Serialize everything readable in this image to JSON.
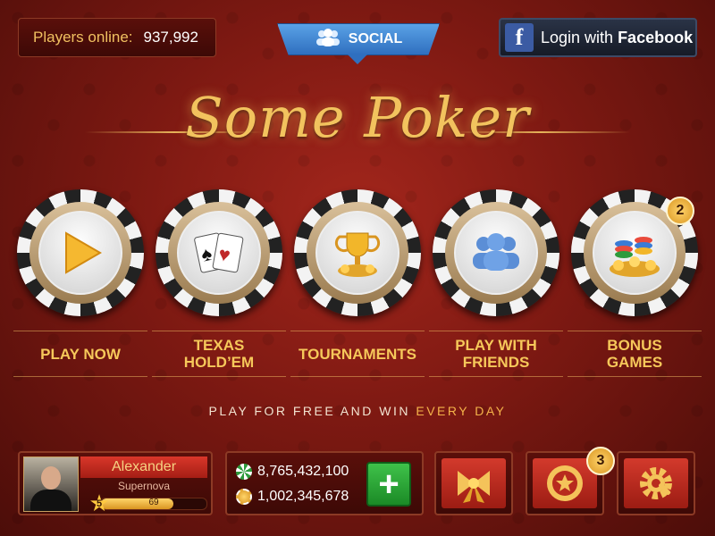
{
  "header": {
    "players_label": "Players online:",
    "players_value": "937,992",
    "social_label": "SOCIAL",
    "facebook_prefix": "Login with",
    "facebook_brand": "Facebook"
  },
  "logo": "Some Poker",
  "games": [
    {
      "label_line1": "PLAY NOW",
      "label_line2": "",
      "icon": "play-icon"
    },
    {
      "label_line1": "TEXAS",
      "label_line2": "HOLD’EM",
      "icon": "cards-icon"
    },
    {
      "label_line1": "TOURNAMENTS",
      "label_line2": "",
      "icon": "trophy-icon"
    },
    {
      "label_line1": "PLAY WITH",
      "label_line2": "FRIENDS",
      "icon": "friends-icon"
    },
    {
      "label_line1": "BONUS",
      "label_line2": "GAMES",
      "icon": "chips-icon",
      "badge": "2"
    }
  ],
  "tagline": {
    "main": "PLAY FOR FREE AND WIN",
    "highlight": "EVERY DAY"
  },
  "profile": {
    "name": "Alexander",
    "rank": "Supernova",
    "level": "5",
    "xp": "69",
    "xp_fraction": 0.69
  },
  "balance": {
    "chips": "8,765,432,100",
    "gold": "1,002,345,678"
  },
  "buttons": {
    "gifts_icon": "bow-icon",
    "achievements_icon": "badge-star-icon",
    "achievements_badge": "3",
    "settings_icon": "gear-icon"
  },
  "colors": {
    "accent_gold": "#f6c85a",
    "background_red": "#7d1912",
    "facebook_blue": "#3b5ba3",
    "add_green": "#2fae3a"
  }
}
